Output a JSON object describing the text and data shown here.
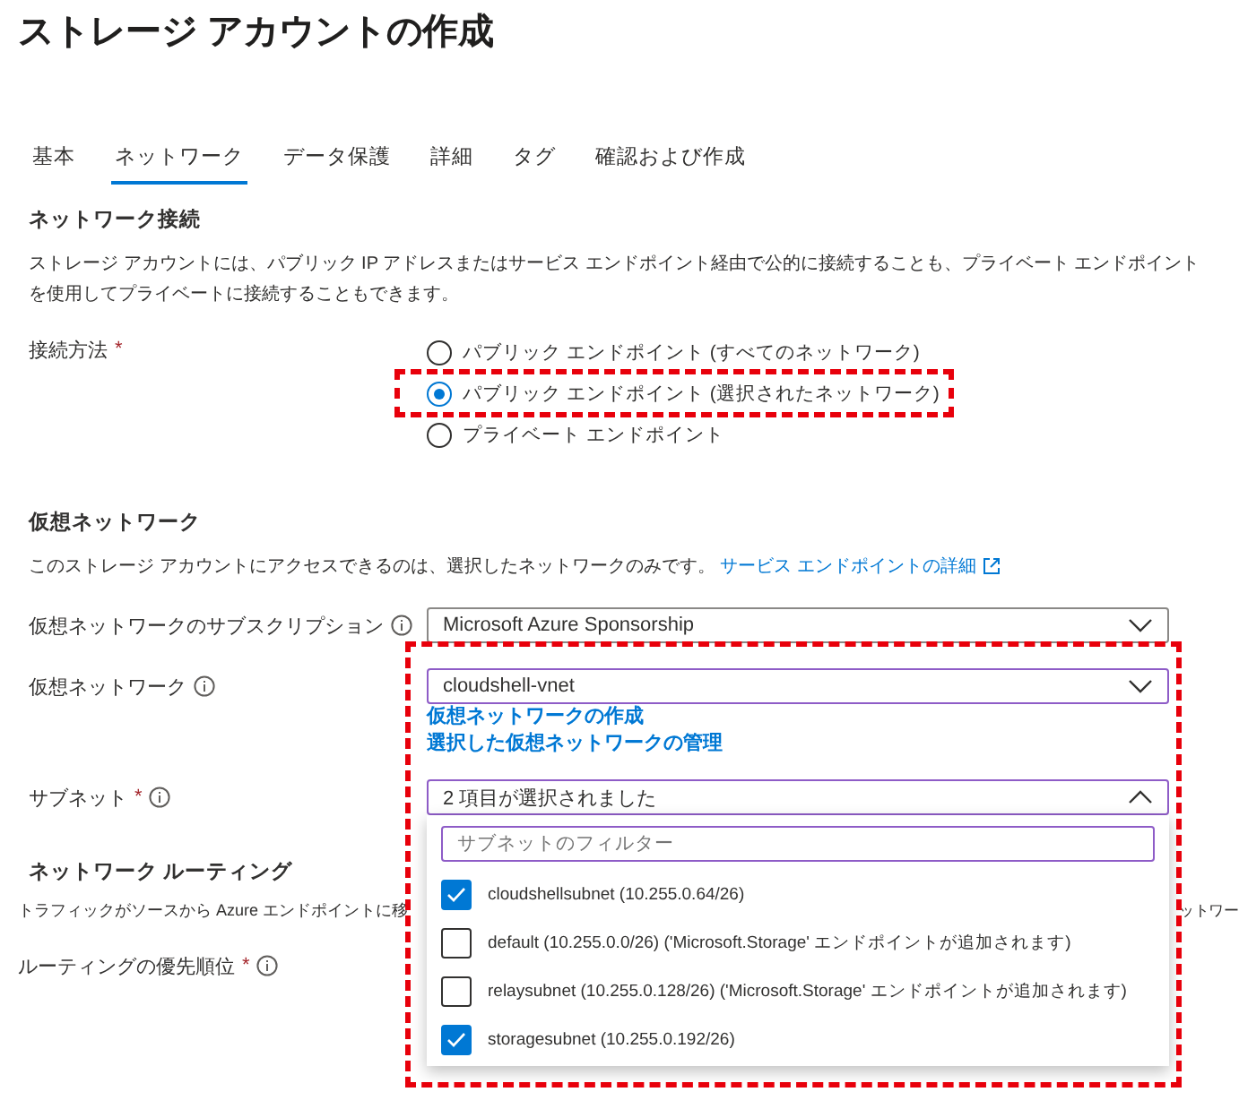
{
  "page_title": "ストレージ アカウントの作成",
  "tabs": [
    {
      "label": "基本",
      "selected": false
    },
    {
      "label": "ネットワーク",
      "selected": true
    },
    {
      "label": "データ保護",
      "selected": false
    },
    {
      "label": "詳細",
      "selected": false
    },
    {
      "label": "タグ",
      "selected": false
    },
    {
      "label": "確認および作成",
      "selected": false
    }
  ],
  "network_connection": {
    "heading": "ネットワーク接続",
    "description": "ストレージ アカウントには、パブリック IP アドレスまたはサービス エンドポイント経由で公的に接続することも、プライベート エンドポイントを使用してプライベートに接続することもできます。",
    "method": {
      "label": "接続方法",
      "required_mark": "*",
      "options": [
        {
          "label": "パブリック エンドポイント (すべてのネットワーク)",
          "selected": false
        },
        {
          "label": "パブリック エンドポイント (選択されたネットワーク)",
          "selected": true
        },
        {
          "label": "プライベート エンドポイント",
          "selected": false
        }
      ]
    }
  },
  "virtual_network": {
    "heading": "仮想ネットワーク",
    "description": "このストレージ アカウントにアクセスできるのは、選択したネットワークのみです。",
    "link": "サービス エンドポイントの詳細",
    "subscription": {
      "label": "仮想ネットワークのサブスクリプション",
      "value": "Microsoft Azure Sponsorship"
    },
    "vnet": {
      "label": "仮想ネットワーク",
      "value": "cloudshell-vnet",
      "links": [
        "仮想ネットワークの作成",
        "選択した仮想ネットワークの管理"
      ]
    },
    "subnet": {
      "label": "サブネット",
      "required_mark": "*",
      "value": "2 項目が選択されました",
      "expanded": true,
      "filter_placeholder": "サブネットのフィルター",
      "options": [
        {
          "label": "cloudshellsubnet (10.255.0.64/26)",
          "checked": true
        },
        {
          "label": "default (10.255.0.0/26) ('Microsoft.Storage' エンドポイントが追加されます)",
          "checked": false
        },
        {
          "label": "relaysubnet (10.255.0.128/26) ('Microsoft.Storage' エンドポイントが追加されます)",
          "checked": false
        },
        {
          "label": "storagesubnet (10.255.0.192/26)",
          "checked": true
        }
      ]
    }
  },
  "network_routing": {
    "heading": "ネットワーク ルーティング",
    "description": "トラフィックがソースから Azure エンドポイントに移",
    "description_tail": "ットワー",
    "priority": {
      "label": "ルーティングの優先順位",
      "required_mark": "*"
    }
  }
}
